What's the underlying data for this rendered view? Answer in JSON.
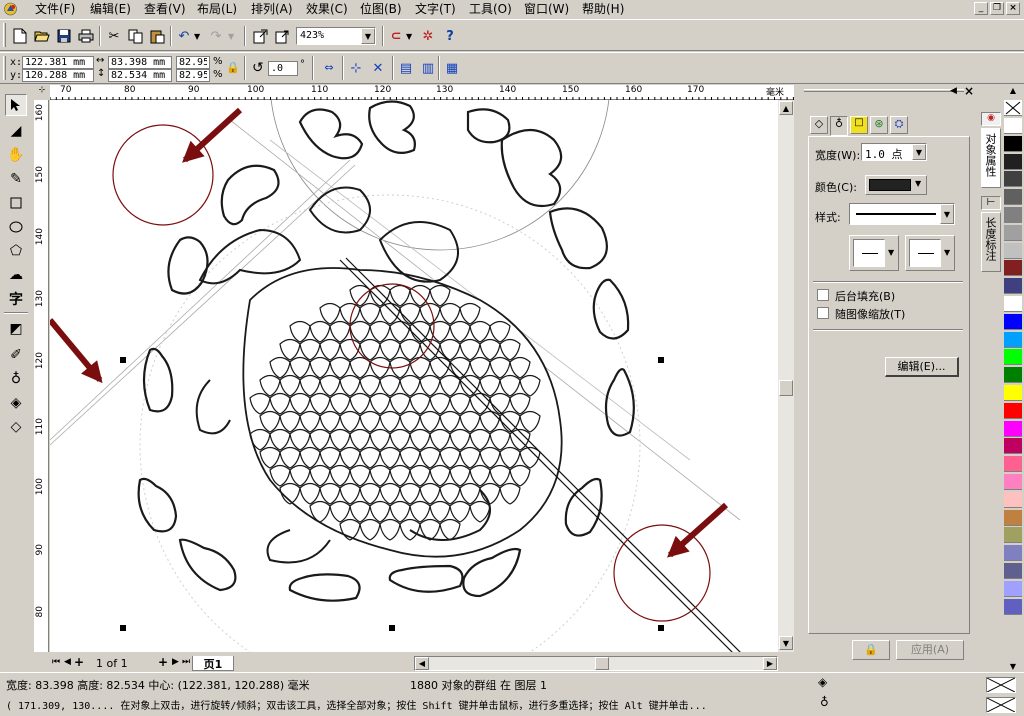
{
  "menubar": {
    "items": [
      "文件(F)",
      "编辑(E)",
      "查看(V)",
      "布局(L)",
      "排列(A)",
      "效果(C)",
      "位图(B)",
      "文字(T)",
      "工具(O)",
      "窗口(W)",
      "帮助(H)"
    ]
  },
  "toolbar": {
    "zoom": "423%"
  },
  "property_bar": {
    "x_label": "x:",
    "y_label": "y:",
    "x_value": "122.381 mm",
    "y_value": "120.288 mm",
    "w_value": "83.398 mm",
    "h_value": "82.534 mm",
    "scale_x": "82.95",
    "scale_y": "82.95",
    "pct": "%",
    "rotation": ".0",
    "degree": "°"
  },
  "ruler": {
    "top_ticks": [
      "70",
      "80",
      "90",
      "100",
      "110",
      "120",
      "130",
      "140",
      "150",
      "160",
      "170"
    ],
    "unit": "毫米",
    "left_ticks": [
      "160",
      "150",
      "140",
      "130",
      "120",
      "110",
      "100",
      "90",
      "80"
    ]
  },
  "page_nav": {
    "counter": "1 of 1",
    "tab": "页1"
  },
  "docker": {
    "width_label": "宽度(W):",
    "width_value": "1.0 点",
    "color_label": "颜色(C):",
    "style_label": "样式:",
    "behind_fill": "后台填充(B)",
    "scale_with_image": "随图像缩放(T)",
    "edit_button": "编辑(E)...",
    "apply_button": "应用(A)",
    "tabs": [
      "对象属性",
      "长度标注"
    ]
  },
  "status": {
    "line1": "宽度: 83.398  高度: 82.534  中心: (122.381, 120.288)  毫米",
    "selection": "1880 对象的群组 在 图层 1",
    "line2": "( 171.309, 130.... 在对象上双击，进行旋转/倾斜；双击该工具，选择全部对象；按住 Shift 键并单击鼠标，进行多重选择；按住 Alt 键并单击..."
  },
  "colors": {
    "accent": "#7a0e0e",
    "palette": [
      "#ffffff",
      "#000000",
      "#202020",
      "#404040",
      "#606060",
      "#808080",
      "#a0a0a0",
      "#c0c0c0",
      "#802020",
      "#404080",
      "#ffffff",
      "#0000ff",
      "#00a0ff",
      "#00ff00",
      "#008000",
      "#ffff00",
      "#ff0000",
      "#ff00ff",
      "#c00060",
      "#ff6090",
      "#ff80c0",
      "#ffc0c0",
      "#c08040",
      "#a0a060",
      "#8080c0",
      "#606090",
      "#a0a0ff",
      "#6060c0"
    ]
  }
}
